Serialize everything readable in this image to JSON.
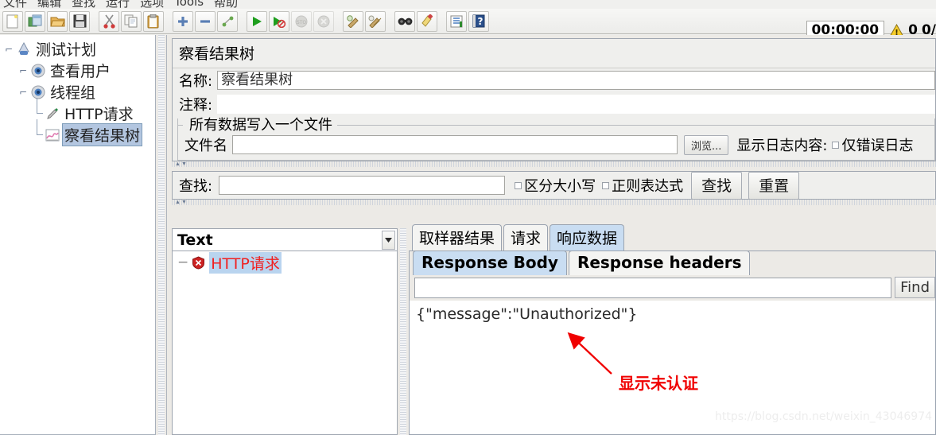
{
  "menu": {
    "items": [
      "文件",
      "编辑",
      "查找",
      "运行",
      "选项",
      "Tools",
      "帮助"
    ]
  },
  "toolbar": {
    "buttons": [
      {
        "name": "new-icon",
        "label": "新建"
      },
      {
        "name": "templates-icon",
        "label": "模板"
      },
      {
        "name": "open-icon",
        "label": "打开"
      },
      {
        "name": "save-icon",
        "label": "保存"
      },
      {
        "name": "cut-icon",
        "label": "剪切"
      },
      {
        "name": "copy-icon",
        "label": "复制"
      },
      {
        "name": "paste-icon",
        "label": "粘贴"
      },
      {
        "name": "expand-icon",
        "label": "展开全部"
      },
      {
        "name": "collapse-icon",
        "label": "收起全部"
      },
      {
        "name": "toggle-icon",
        "label": "切换"
      },
      {
        "name": "start-icon",
        "label": "启动"
      },
      {
        "name": "start-no-pause-icon",
        "label": "无间断启动"
      },
      {
        "name": "stop-icon",
        "label": "停止"
      },
      {
        "name": "shutdown-icon",
        "label": "关闭"
      },
      {
        "name": "clear-icon",
        "label": "清除"
      },
      {
        "name": "clear-all-icon",
        "label": "清除全部"
      },
      {
        "name": "search-icon",
        "label": "查找"
      },
      {
        "name": "search-reset-icon",
        "label": "重置查找"
      },
      {
        "name": "function-helper-icon",
        "label": "函数助手"
      },
      {
        "name": "help-icon",
        "label": "帮助"
      }
    ]
  },
  "status": {
    "timer": "00:00:00",
    "warn_count": "0",
    "threads": "0/"
  },
  "tree": {
    "nodes": [
      {
        "label": "测试计划",
        "icon": "test-plan-icon",
        "depth": 0,
        "selected": false
      },
      {
        "label": "查看用户",
        "icon": "thread-group-icon",
        "depth": 1,
        "selected": false
      },
      {
        "label": "线程组",
        "icon": "thread-group-icon",
        "depth": 1,
        "selected": false
      },
      {
        "label": "HTTP请求",
        "icon": "http-request-icon",
        "depth": 2,
        "selected": false
      },
      {
        "label": "察看结果树",
        "icon": "view-results-tree-icon",
        "depth": 2,
        "selected": true
      }
    ]
  },
  "panel": {
    "title": "察看结果树",
    "name_label": "名称:",
    "name_value": "察看结果树",
    "comment_label": "注释:",
    "comment_value": "",
    "group_legend": "所有数据写入一个文件",
    "filename_label": "文件名",
    "filename_value": "",
    "browse_button": "浏览...",
    "log_display_label": "显示日志内容:",
    "errors_only_label": "仅错误日志"
  },
  "search": {
    "label": "查找:",
    "value": "",
    "case_sensitive_label": "区分大小写",
    "regex_label": "正则表达式",
    "search_button": "查找",
    "reset_button": "重置"
  },
  "results": {
    "renderer_selected": "Text",
    "rows": [
      {
        "label": "HTTP请求",
        "status": "error"
      }
    ]
  },
  "tabs": {
    "main": [
      {
        "label": "取样器结果",
        "active": false
      },
      {
        "label": "请求",
        "active": false
      },
      {
        "label": "响应数据",
        "active": true
      }
    ],
    "sub": [
      {
        "label": "Response Body",
        "active": true
      },
      {
        "label": "Response headers",
        "active": false
      }
    ]
  },
  "response": {
    "find_value": "",
    "find_button": "Find",
    "body": "{\"message\":\"Unauthorized\"}"
  },
  "annotation": {
    "text": "显示未认证",
    "color": "#f00000"
  },
  "watermark": {
    "text": "https://blog.csdn.net/weixin_43046974"
  }
}
